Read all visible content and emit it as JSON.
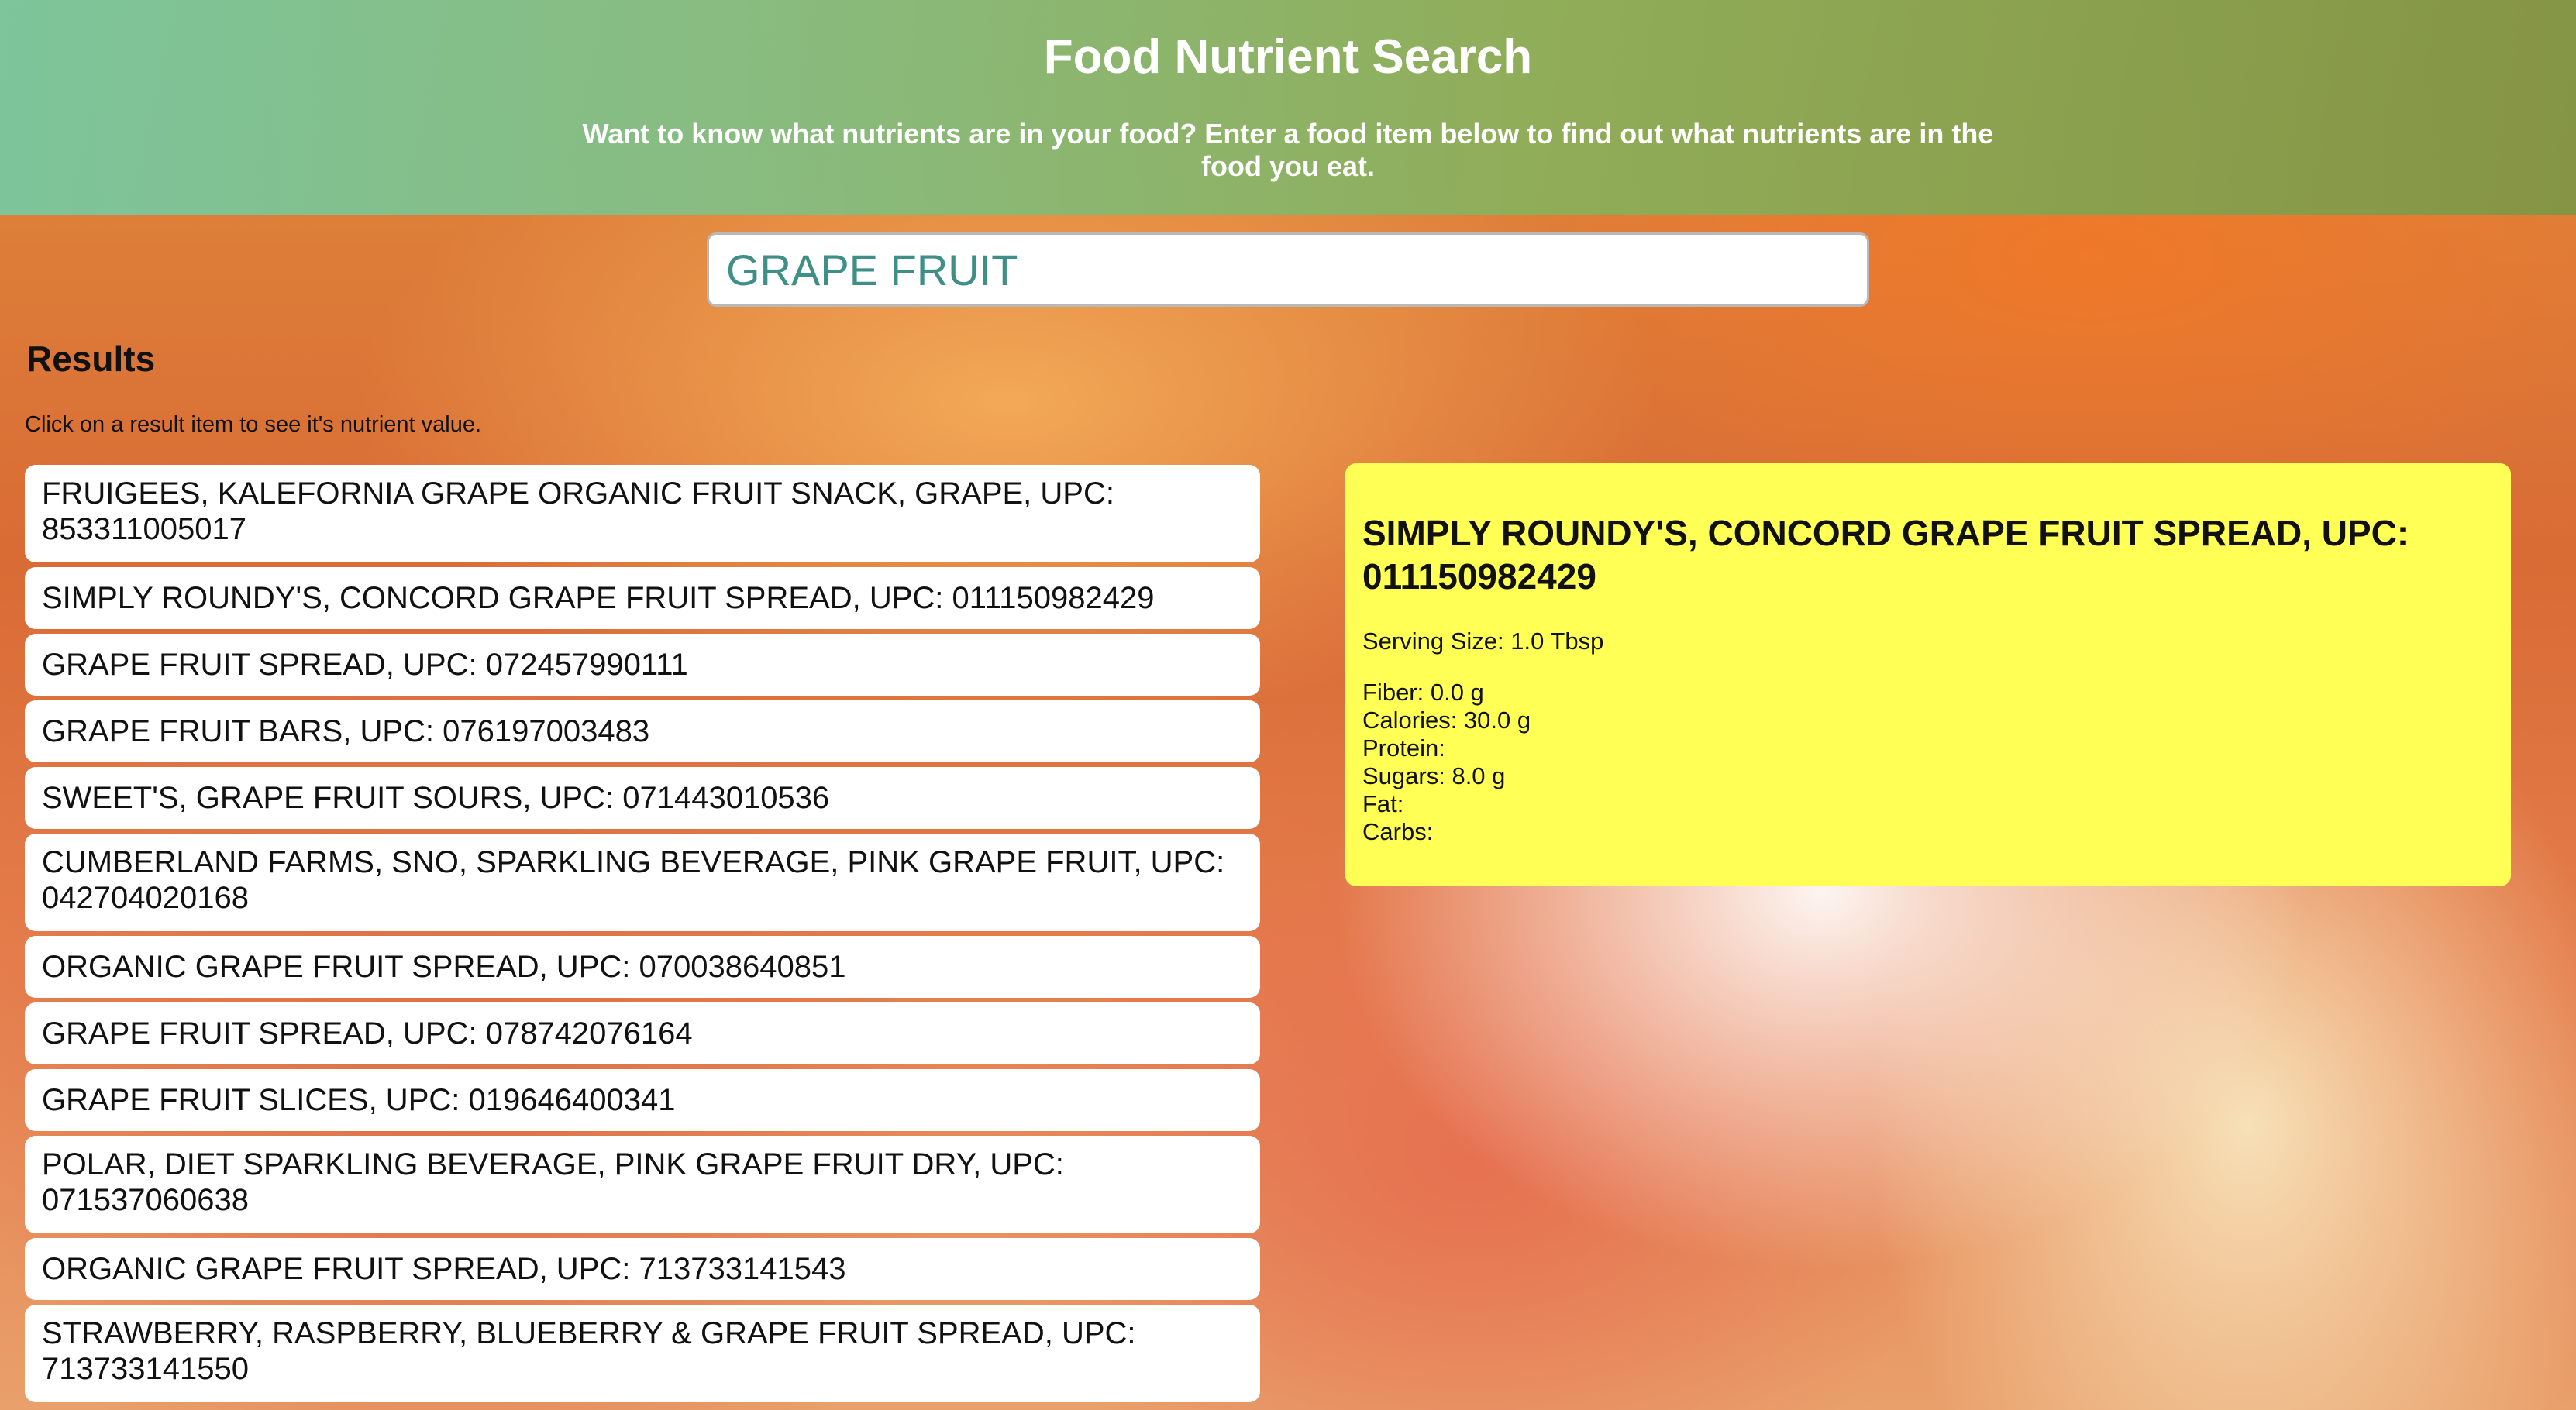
{
  "header": {
    "title": "Food Nutrient Search",
    "subtitle": "Want to know what nutrients are in your food? Enter a food item below to find out what nutrients are in the food you eat."
  },
  "search": {
    "value": "GRAPE FRUIT"
  },
  "results": {
    "title": "Results",
    "hint": "Click on a result item to see it's nutrient value.",
    "items": [
      "FRUIGEES, KALEFORNIA GRAPE ORGANIC FRUIT SNACK, GRAPE, UPC: 853311005017",
      "SIMPLY ROUNDY'S, CONCORD GRAPE FRUIT SPREAD, UPC: 011150982429",
      "GRAPE FRUIT SPREAD, UPC: 072457990111",
      "GRAPE FRUIT BARS, UPC: 076197003483",
      "SWEET'S, GRAPE FRUIT SOURS, UPC: 071443010536",
      "CUMBERLAND FARMS, SNO, SPARKLING BEVERAGE, PINK GRAPE FRUIT, UPC: 042704020168",
      "ORGANIC GRAPE FRUIT SPREAD, UPC: 070038640851",
      "GRAPE FRUIT SPREAD, UPC: 078742076164",
      "GRAPE FRUIT SLICES, UPC: 019646400341",
      "POLAR, DIET SPARKLING BEVERAGE, PINK GRAPE FRUIT DRY, UPC: 071537060638",
      "ORGANIC GRAPE FRUIT SPREAD, UPC: 713733141543",
      "STRAWBERRY, RASPBERRY, BLUEBERRY & GRAPE FRUIT SPREAD, UPC: 713733141550"
    ]
  },
  "detail": {
    "title": "SIMPLY ROUNDY'S, CONCORD GRAPE FRUIT SPREAD, UPC: 011150982429",
    "serving": "Serving Size: 1.0 Tbsp",
    "nutrients": [
      "Fiber: 0.0 g",
      "Calories: 30.0 g",
      "Protein:",
      "Sugars: 8.0 g",
      "Fat:",
      "Carbs:"
    ]
  },
  "colors": {
    "detail_background": "#ffff55",
    "search_text": "#3f8f86",
    "header_text": "#ffffff"
  }
}
